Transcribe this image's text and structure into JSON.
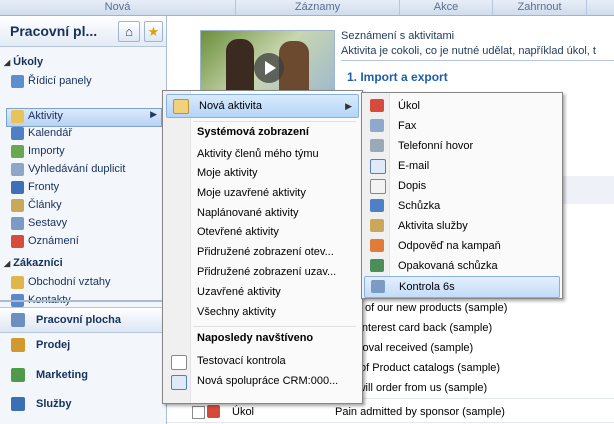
{
  "ribbon": {
    "groups": [
      "Nová",
      "Záznamy",
      "Akce",
      "Zahrnout"
    ]
  },
  "nav": {
    "title": "Pracovní pl...",
    "sections": [
      {
        "header": "Úkoly",
        "items": [
          "Řídicí panely",
          "Aktivity",
          "Kalendář",
          "Importy",
          "Vyhledávání duplicit",
          "Fronty",
          "Články",
          "Sestavy",
          "Oznámení"
        ]
      },
      {
        "header": "Zákazníci",
        "items": [
          "Obchodní vztahy",
          "Kontakty"
        ]
      }
    ],
    "workspaces": [
      "Pracovní plocha",
      "Prodej",
      "Marketing",
      "Služby"
    ]
  },
  "info": {
    "title": "Seznámení s aktivitami",
    "description": "Aktivita je cokoli, co je nutné udělat, například úkol, t",
    "import_link": "1. Import a export"
  },
  "menu1": {
    "new_activity": "Nová aktivita",
    "system_header": "Systémová zobrazení",
    "system_items": [
      "Aktivity členů mého týmu",
      "Moje aktivity",
      "Moje uzavřené aktivity",
      "Naplánované aktivity",
      "Otevřené aktivity",
      "Přidružené zobrazení otev...",
      "Přidružené zobrazení uzav...",
      "Uzavřené aktivity",
      "Všechny aktivity"
    ],
    "recent_header": "Naposledy navštíveno",
    "recent_items": [
      "Testovací kontrola",
      "Nová spolupráce CRM:000..."
    ]
  },
  "menu2": {
    "items": [
      "Úkol",
      "Fax",
      "Telefonní hovor",
      "E-mail",
      "Dopis",
      "Schůzka",
      "Aktivita služby",
      "Odpověď na kampaň",
      "Opakovaná schůzka",
      "Kontrola 6s"
    ]
  },
  "grid_rows": [
    "some of our new products (sample)",
    "d an interest card back (sample)",
    "l approval received (sample)",
    "bility of Product catalogs (sample)",
    "kely will order from us (sample)"
  ],
  "bottom_row": {
    "type": "Úkol",
    "subject": "Pain admitted by sponsor (sample)"
  },
  "colors": {
    "accent": "#1c5ea8",
    "highlight": "#b3d4f8",
    "nav_text": "#15315c"
  }
}
